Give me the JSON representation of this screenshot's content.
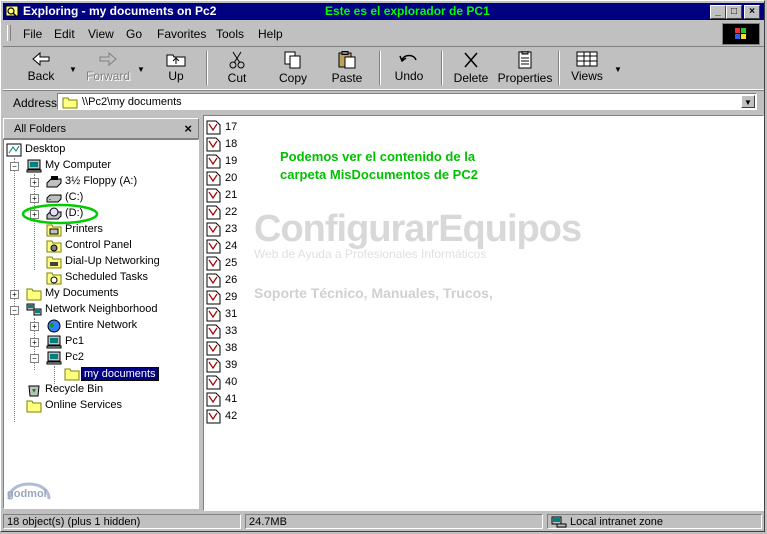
{
  "window": {
    "title": "Exploring - my documents on Pc2",
    "annotation": "Este es el explorador de PC1",
    "controls": [
      "_",
      "□",
      "×"
    ]
  },
  "menu": [
    "File",
    "Edit",
    "View",
    "Go",
    "Favorites",
    "Tools",
    "Help"
  ],
  "toolbar": {
    "back": "Back",
    "forward": "Forward",
    "up": "Up",
    "cut": "Cut",
    "copy": "Copy",
    "paste": "Paste",
    "undo": "Undo",
    "delete": "Delete",
    "properties": "Properties",
    "views": "Views"
  },
  "address": {
    "label": "Address",
    "value": "\\\\Pc2\\my documents"
  },
  "folders_pane": {
    "title": "All Folders",
    "close": "×",
    "tree": {
      "desktop": "Desktop",
      "my_computer": "My Computer",
      "floppy": "3½ Floppy (A:)",
      "c_drive": "(C:)",
      "d_drive": "(D:)",
      "printers": "Printers",
      "control_panel": "Control Panel",
      "dialup": "Dial-Up Networking",
      "scheduled_tasks": "Scheduled Tasks",
      "my_documents": "My Documents",
      "network_neighborhood": "Network Neighborhood",
      "entire_network": "Entire Network",
      "pc1": "Pc1",
      "pc2": "Pc2",
      "pc2_my_documents": "my documents",
      "recycle_bin": "Recycle Bin",
      "online_services": "Online Services"
    }
  },
  "files": [
    "17",
    "18",
    "19",
    "20",
    "21",
    "22",
    "23",
    "24",
    "25",
    "26",
    "29",
    "31",
    "33",
    "38",
    "39",
    "40",
    "41",
    "42"
  ],
  "annotation": {
    "line1": "Podemos ver el contenido de la",
    "line2": "carpeta MisDocumentos de PC2"
  },
  "watermark": {
    "title": "ConfigurarEquipos",
    "subtitle": "Web de Ayuda a Profesionales Informáticos",
    "tagline": "Soporte Técnico, Manuales, Trucos,"
  },
  "status": {
    "objects": "18 object(s) (plus 1 hidden)",
    "size": "24.7MB",
    "zone": "Local intranet zone"
  },
  "logo": {
    "text": "godmol"
  },
  "colors": {
    "titlebar": "#000080",
    "annotation_green": "#00c000",
    "title_annotation": "#00ff00",
    "highlight_circle": "#00cc00"
  }
}
